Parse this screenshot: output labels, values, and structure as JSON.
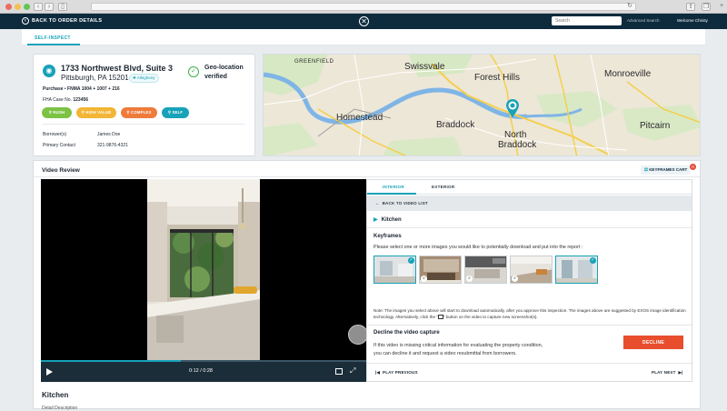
{
  "browser": {
    "traffic_lights": [
      "#ed6b60",
      "#f5c04f",
      "#62c655"
    ]
  },
  "header": {
    "back_label": "BACK TO ORDER DETAILS",
    "search_placeholder": "Search",
    "advanced_search": "Advanced Search",
    "welcome": "Welcome Christy",
    "bg_color": "#0e2a3d"
  },
  "tabs": {
    "active": "SELF-INSPECT",
    "accent": "#16a2b8"
  },
  "property": {
    "address_line1": "1733 Northwest Blvd, Suite 3",
    "address_line2": "Pittsburgh, PA 15201",
    "county": "Allegheny",
    "geo_line1": "Geo-location",
    "geo_line2": "verified",
    "purpose_label": "Purchase",
    "purpose_detail": "FNMA 1004 + 1007 + 216",
    "fha_label": "FHA Case No.",
    "fha_value": "123456",
    "tags": [
      {
        "label": "RUSH",
        "color": "#7cc244"
      },
      {
        "label": "HIGH VALUE",
        "color": "#f2b535"
      },
      {
        "label": "COMPLEX",
        "color": "#ef7b3b"
      },
      {
        "label": "SELF",
        "color": "#17a2b8"
      }
    ],
    "borrowers_label": "Borrower(s)",
    "borrowers_value": "James Doe",
    "contact_label": "Primary Contact",
    "contact_value": "321-9876-4321"
  },
  "map": {
    "labels": [
      "GREENFIELD",
      "Swissvale",
      "Forest Hills",
      "Monroeville",
      "Homestead",
      "Braddock",
      "North",
      "Braddock",
      "Pitcairn"
    ]
  },
  "video_review": {
    "title": "Video Review",
    "keyframes_cart": "KEYFRAMES CART",
    "cart_count": "0",
    "time": "0:12 / 0:28",
    "progress_fraction": 0.43,
    "tabs": [
      "INTERIOR",
      "EXTERIOR"
    ],
    "back_to_list": "BACK TO VIDEO LIST",
    "room": "Kitchen",
    "keyframes_title": "Keyframes",
    "keyframes_desc": "Please select one or more images you would like to potentially download and put into the report :",
    "note": "Note: The images you select above will start to download automatically, after you approve this inspection. The images above are suggested by EXOS image identification technology. Alternatively, click the \"",
    "note_tail": "\" button on the video to capture new screenshot(s).",
    "decline_title": "Decline the video capture",
    "decline_text1": "If this video is missing critical information for evaluating the property condition,",
    "decline_text2": "you can decline it and request a video resubmittal from borrowers.",
    "decline_button": "DECLINE",
    "decline_color": "#e84e2e",
    "play_previous": "PLAY PREVIOUS",
    "play_next": "PLAY NEXT"
  },
  "section": {
    "heading": "Kitchen",
    "sub": "Detail Description"
  }
}
